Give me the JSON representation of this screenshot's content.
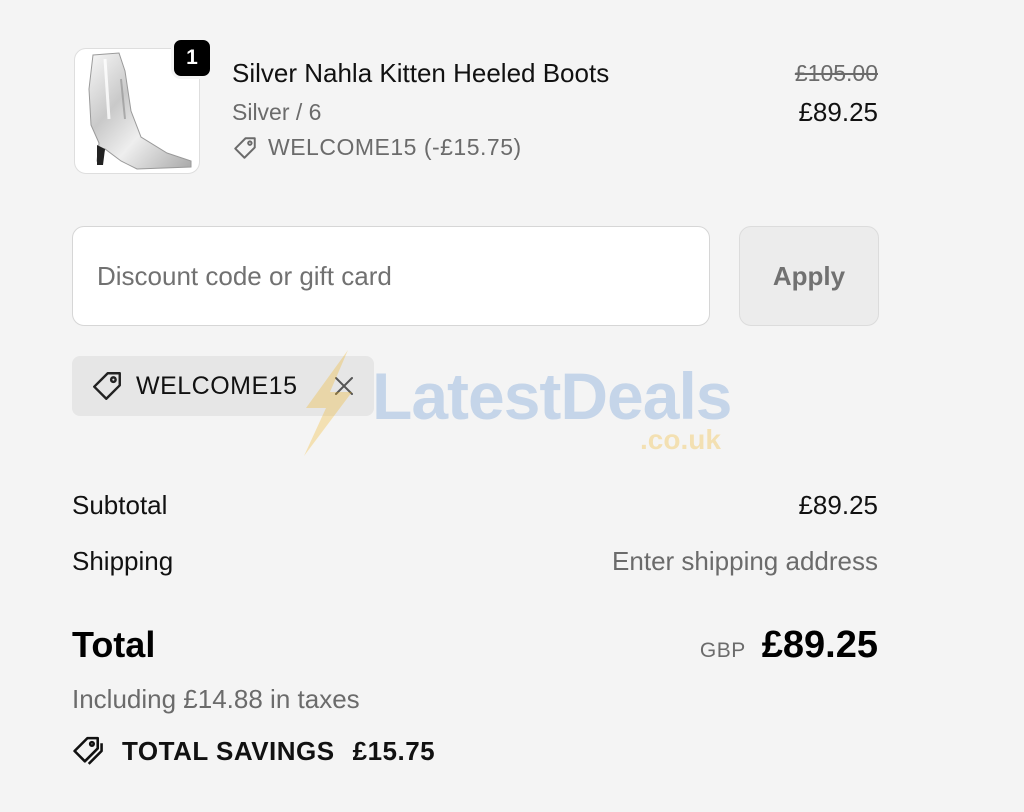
{
  "cart_item": {
    "quantity": "1",
    "name": "Silver Nahla Kitten Heeled Boots",
    "variant": "Silver / 6",
    "discount_line": "WELCOME15 (-£15.75)",
    "original_price": "£105.00",
    "price": "£89.25",
    "image_icon": "silver-boot-image"
  },
  "discount_form": {
    "placeholder": "Discount code or gift card",
    "value": "",
    "apply_label": "Apply"
  },
  "applied_code": {
    "label": "WELCOME15",
    "tag_icon": "tag-icon",
    "remove_icon": "close-icon"
  },
  "watermark": {
    "brand": "LatestDeals",
    "domain": ".co.uk"
  },
  "summary": {
    "subtotal_label": "Subtotal",
    "subtotal_value": "£89.25",
    "shipping_label": "Shipping",
    "shipping_value": "Enter shipping address",
    "total_label": "Total",
    "currency": "GBP",
    "total_value": "£89.25",
    "tax_note": "Including £14.88 in taxes",
    "savings_label": "TOTAL SAVINGS",
    "savings_value": "£15.75",
    "savings_icon": "double-tag-icon"
  },
  "colors": {
    "background": "#f4f4f4",
    "text": "#111111",
    "muted": "#6b6b6b",
    "chip": "#e6e6e6",
    "apply_disabled": "#ececec"
  }
}
